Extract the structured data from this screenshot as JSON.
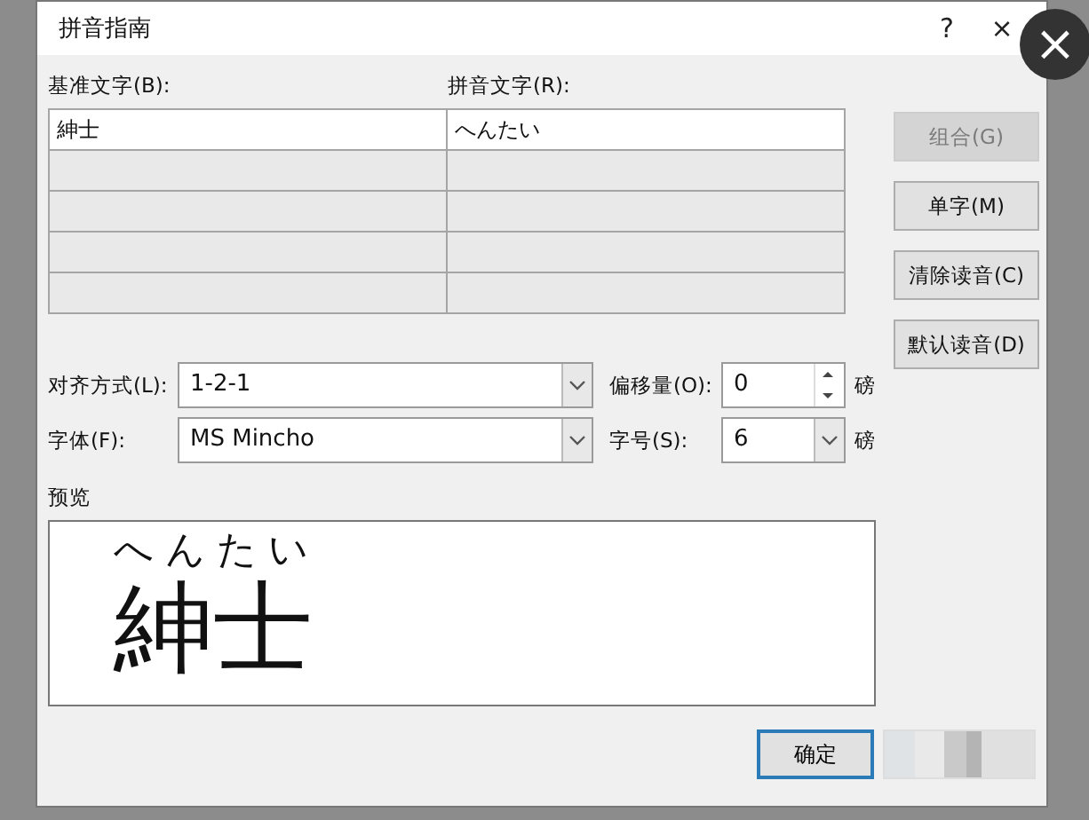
{
  "window": {
    "title": "拼音指南",
    "help": "?",
    "close": "×"
  },
  "overlay_close": {
    "label": "×"
  },
  "columns": {
    "base": "基准文字(B):",
    "ruby": "拼音文字(R):"
  },
  "rows": [
    {
      "base": "紳士",
      "ruby": "へんたい",
      "enabled": true
    },
    {
      "enabled": false
    },
    {
      "enabled": false
    },
    {
      "enabled": false
    },
    {
      "enabled": false
    }
  ],
  "side_buttons": [
    {
      "label": "组合(G)",
      "disabled": true
    },
    {
      "label": "单字(M)",
      "disabled": false
    },
    {
      "label": "清除读音(C)",
      "disabled": false
    },
    {
      "label": "默认读音(D)",
      "disabled": false
    }
  ],
  "alignment": {
    "label": "对齐方式(L):",
    "value": "1-2-1"
  },
  "font": {
    "label": "字体(F):",
    "value": "MS Mincho"
  },
  "offset": {
    "label": "偏移量(O):",
    "value": "0",
    "unit": "磅"
  },
  "size": {
    "label": "字号(S):",
    "value": "6",
    "unit": "磅"
  },
  "preview": {
    "label": "预览",
    "ruby": "へんたい",
    "base": "紳士"
  },
  "footer_buttons": [
    {
      "kind": "default",
      "label": "确定"
    },
    {
      "kind": "obscured"
    }
  ]
}
